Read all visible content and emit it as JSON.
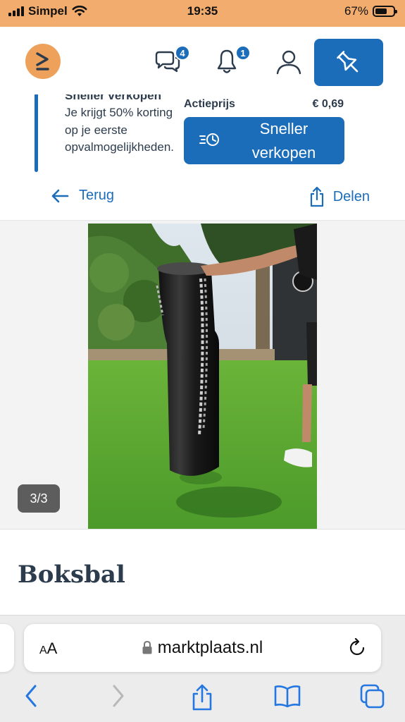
{
  "status_bar": {
    "carrier": "Simpel",
    "time": "19:35",
    "battery": "67%",
    "battery_level": 0.67,
    "icons": [
      "signal-icon",
      "wifi-icon",
      "battery-icon"
    ]
  },
  "header": {
    "logo": "marktplaats-logo",
    "messages_badge": "4",
    "notifications_badge": "1",
    "icons": [
      "chat-icon",
      "bell-icon",
      "user-icon",
      "pin-icon"
    ]
  },
  "promo": {
    "title": "Sneller verkopen",
    "text": "Je krijgt 50% korting op je eerste opvalmogelijkheden.",
    "price_label": "Actieprijs",
    "price_value": "€ 0,69",
    "button_label": "Sneller verkopen"
  },
  "actions": {
    "back_label": "Terug",
    "share_label": "Delen"
  },
  "gallery": {
    "counter": "3/3",
    "image_alt": "Zwarte bokszak met ketting op een grasveld"
  },
  "listing": {
    "title": "Boksbal"
  },
  "browser": {
    "text_size_label_small": "A",
    "text_size_label_large": "A",
    "url": "marktplaats.nl",
    "nav_icons": [
      "back-icon",
      "forward-icon",
      "share-icon",
      "bookmarks-icon",
      "tabs-icon"
    ]
  },
  "colors": {
    "status_bar": "#f2ac6e",
    "brand_blue": "#1c6db9",
    "logo_orange": "#eea15a",
    "text_dark": "#2d3c4d"
  }
}
